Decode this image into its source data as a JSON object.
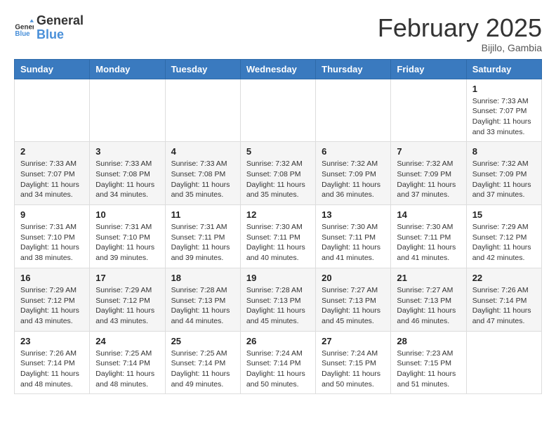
{
  "logo": {
    "line1": "General",
    "line2": "Blue"
  },
  "title": "February 2025",
  "location": "Bijilo, Gambia",
  "days_of_week": [
    "Sunday",
    "Monday",
    "Tuesday",
    "Wednesday",
    "Thursday",
    "Friday",
    "Saturday"
  ],
  "weeks": [
    [
      {
        "day": "",
        "info": ""
      },
      {
        "day": "",
        "info": ""
      },
      {
        "day": "",
        "info": ""
      },
      {
        "day": "",
        "info": ""
      },
      {
        "day": "",
        "info": ""
      },
      {
        "day": "",
        "info": ""
      },
      {
        "day": "1",
        "info": "Sunrise: 7:33 AM\nSunset: 7:07 PM\nDaylight: 11 hours and 33 minutes."
      }
    ],
    [
      {
        "day": "2",
        "info": "Sunrise: 7:33 AM\nSunset: 7:07 PM\nDaylight: 11 hours and 34 minutes."
      },
      {
        "day": "3",
        "info": "Sunrise: 7:33 AM\nSunset: 7:08 PM\nDaylight: 11 hours and 34 minutes."
      },
      {
        "day": "4",
        "info": "Sunrise: 7:33 AM\nSunset: 7:08 PM\nDaylight: 11 hours and 35 minutes."
      },
      {
        "day": "5",
        "info": "Sunrise: 7:32 AM\nSunset: 7:08 PM\nDaylight: 11 hours and 35 minutes."
      },
      {
        "day": "6",
        "info": "Sunrise: 7:32 AM\nSunset: 7:09 PM\nDaylight: 11 hours and 36 minutes."
      },
      {
        "day": "7",
        "info": "Sunrise: 7:32 AM\nSunset: 7:09 PM\nDaylight: 11 hours and 37 minutes."
      },
      {
        "day": "8",
        "info": "Sunrise: 7:32 AM\nSunset: 7:09 PM\nDaylight: 11 hours and 37 minutes."
      }
    ],
    [
      {
        "day": "9",
        "info": "Sunrise: 7:31 AM\nSunset: 7:10 PM\nDaylight: 11 hours and 38 minutes."
      },
      {
        "day": "10",
        "info": "Sunrise: 7:31 AM\nSunset: 7:10 PM\nDaylight: 11 hours and 39 minutes."
      },
      {
        "day": "11",
        "info": "Sunrise: 7:31 AM\nSunset: 7:11 PM\nDaylight: 11 hours and 39 minutes."
      },
      {
        "day": "12",
        "info": "Sunrise: 7:30 AM\nSunset: 7:11 PM\nDaylight: 11 hours and 40 minutes."
      },
      {
        "day": "13",
        "info": "Sunrise: 7:30 AM\nSunset: 7:11 PM\nDaylight: 11 hours and 41 minutes."
      },
      {
        "day": "14",
        "info": "Sunrise: 7:30 AM\nSunset: 7:11 PM\nDaylight: 11 hours and 41 minutes."
      },
      {
        "day": "15",
        "info": "Sunrise: 7:29 AM\nSunset: 7:12 PM\nDaylight: 11 hours and 42 minutes."
      }
    ],
    [
      {
        "day": "16",
        "info": "Sunrise: 7:29 AM\nSunset: 7:12 PM\nDaylight: 11 hours and 43 minutes."
      },
      {
        "day": "17",
        "info": "Sunrise: 7:29 AM\nSunset: 7:12 PM\nDaylight: 11 hours and 43 minutes."
      },
      {
        "day": "18",
        "info": "Sunrise: 7:28 AM\nSunset: 7:13 PM\nDaylight: 11 hours and 44 minutes."
      },
      {
        "day": "19",
        "info": "Sunrise: 7:28 AM\nSunset: 7:13 PM\nDaylight: 11 hours and 45 minutes."
      },
      {
        "day": "20",
        "info": "Sunrise: 7:27 AM\nSunset: 7:13 PM\nDaylight: 11 hours and 45 minutes."
      },
      {
        "day": "21",
        "info": "Sunrise: 7:27 AM\nSunset: 7:13 PM\nDaylight: 11 hours and 46 minutes."
      },
      {
        "day": "22",
        "info": "Sunrise: 7:26 AM\nSunset: 7:14 PM\nDaylight: 11 hours and 47 minutes."
      }
    ],
    [
      {
        "day": "23",
        "info": "Sunrise: 7:26 AM\nSunset: 7:14 PM\nDaylight: 11 hours and 48 minutes."
      },
      {
        "day": "24",
        "info": "Sunrise: 7:25 AM\nSunset: 7:14 PM\nDaylight: 11 hours and 48 minutes."
      },
      {
        "day": "25",
        "info": "Sunrise: 7:25 AM\nSunset: 7:14 PM\nDaylight: 11 hours and 49 minutes."
      },
      {
        "day": "26",
        "info": "Sunrise: 7:24 AM\nSunset: 7:14 PM\nDaylight: 11 hours and 50 minutes."
      },
      {
        "day": "27",
        "info": "Sunrise: 7:24 AM\nSunset: 7:15 PM\nDaylight: 11 hours and 50 minutes."
      },
      {
        "day": "28",
        "info": "Sunrise: 7:23 AM\nSunset: 7:15 PM\nDaylight: 11 hours and 51 minutes."
      },
      {
        "day": "",
        "info": ""
      }
    ]
  ]
}
